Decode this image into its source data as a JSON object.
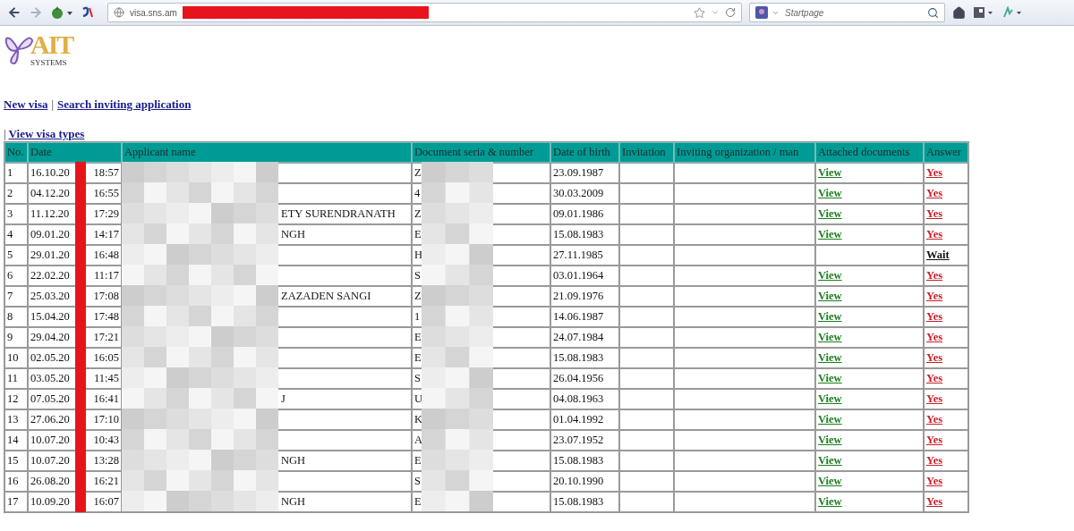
{
  "browser": {
    "url": "visa.sns.am",
    "search_placeholder": "Startpage"
  },
  "logo": {
    "title": "AIT",
    "subtitle": "SYSTEMS"
  },
  "nav_links": [
    "New visa",
    "Search inviting application"
  ],
  "nav_separator": "|",
  "sub_separator": "|",
  "sub_link": "View visa types",
  "table": {
    "columns": [
      "No.",
      "Date",
      "Applicant name",
      "Document seria & number",
      "Date of birth",
      "Invitation",
      "Inviting organization / man",
      "Attached documents",
      "Answer"
    ],
    "rows": [
      {
        "no": "1",
        "date": "16.10.20",
        "time": "18:57",
        "document": "Z",
        "birth_date": "23.09.1987",
        "attached": "View",
        "answer": {
          "kind": "yes",
          "text": "Yes"
        }
      },
      {
        "no": "2",
        "date": "04.12.20",
        "time": "16:55",
        "document": "4",
        "birth_date": "30.03.2009",
        "attached": "View",
        "answer": {
          "kind": "yes",
          "text": "Yes"
        }
      },
      {
        "no": "3",
        "date": "11.12.20",
        "time": "17:29",
        "applicant": "ETY SURENDRANATH",
        "document": "Z",
        "birth_date": "09.01.1986",
        "attached": "View",
        "answer": {
          "kind": "yes",
          "text": "Yes"
        }
      },
      {
        "no": "4",
        "date": "09.01.20",
        "time": "14:17",
        "applicant": "NGH",
        "document": "E",
        "birth_date": "15.08.1983",
        "attached": "View",
        "answer": {
          "kind": "yes",
          "text": "Yes"
        }
      },
      {
        "no": "5",
        "date": "29.01.20",
        "time": "16:48",
        "document": "H",
        "birth_date": "27.11.1985",
        "answer": {
          "kind": "wait",
          "text": "Wait"
        }
      },
      {
        "no": "6",
        "date": "22.02.20",
        "time": "11:17",
        "document": "S",
        "birth_date": "03.01.1964",
        "attached": "View",
        "answer": {
          "kind": "yes",
          "text": "Yes"
        }
      },
      {
        "no": "7",
        "date": "25.03.20",
        "time": "17:08",
        "applicant": "ZAZADEN SANGI",
        "document": "Z",
        "birth_date": "21.09.1976",
        "attached": "View",
        "answer": {
          "kind": "yes",
          "text": "Yes"
        }
      },
      {
        "no": "8",
        "date": "15.04.20",
        "time": "17:48",
        "document": "1",
        "birth_date": "14.06.1987",
        "attached": "View",
        "answer": {
          "kind": "yes",
          "text": "Yes"
        }
      },
      {
        "no": "9",
        "date": "29.04.20",
        "time": "17:21",
        "document": "E",
        "birth_date": "24.07.1984",
        "attached": "View",
        "answer": {
          "kind": "yes",
          "text": "Yes"
        }
      },
      {
        "no": "10",
        "date": "02.05.20",
        "time": "16:05",
        "document": "E",
        "birth_date": "15.08.1983",
        "attached": "View",
        "answer": {
          "kind": "yes",
          "text": "Yes"
        }
      },
      {
        "no": "11",
        "date": "03.05.20",
        "time": "11:45",
        "document": "S",
        "birth_date": "26.04.1956",
        "attached": "View",
        "answer": {
          "kind": "yes",
          "text": "Yes"
        }
      },
      {
        "no": "12",
        "date": "07.05.20",
        "time": "16:41",
        "applicant": "J",
        "document": "U",
        "birth_date": "04.08.1963",
        "attached": "View",
        "answer": {
          "kind": "yes",
          "text": "Yes"
        }
      },
      {
        "no": "13",
        "date": "27.06.20",
        "time": "17:10",
        "document": "K",
        "birth_date": "01.04.1992",
        "attached": "View",
        "answer": {
          "kind": "yes",
          "text": "Yes"
        }
      },
      {
        "no": "14",
        "date": "10.07.20",
        "time": "10:43",
        "document": "A",
        "birth_date": "23.07.1952",
        "attached": "View",
        "answer": {
          "kind": "yes",
          "text": "Yes"
        }
      },
      {
        "no": "15",
        "date": "10.07.20",
        "time": "13:28",
        "applicant": "NGH",
        "document": "E",
        "birth_date": "15.08.1983",
        "attached": "View",
        "answer": {
          "kind": "yes",
          "text": "Yes"
        }
      },
      {
        "no": "16",
        "date": "26.08.20",
        "time": "16:21",
        "document": "S",
        "birth_date": "20.10.1990",
        "attached": "View",
        "answer": {
          "kind": "yes",
          "text": "Yes"
        }
      },
      {
        "no": "17",
        "date": "10.09.20",
        "time": "16:07",
        "applicant": "NGH",
        "document": "E",
        "birth_date": "15.08.1983",
        "attached": "View",
        "answer": {
          "kind": "yes",
          "text": "Yes"
        }
      }
    ]
  }
}
